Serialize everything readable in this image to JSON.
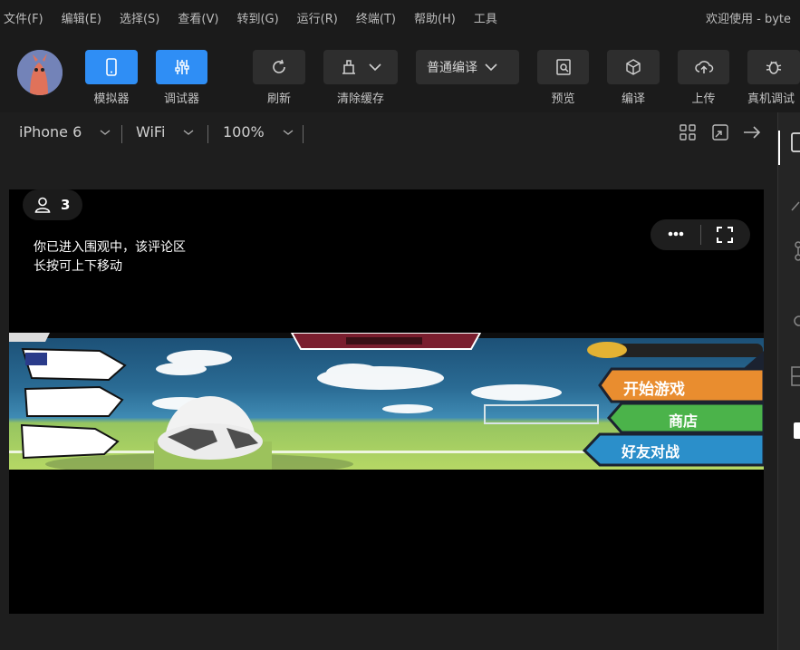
{
  "menu": {
    "items": [
      "文件(F)",
      "编辑(E)",
      "选择(S)",
      "查看(V)",
      "转到(G)",
      "运行(R)",
      "终端(T)",
      "帮助(H)",
      "工具"
    ],
    "welcome": "欢迎使用 - byte"
  },
  "toolbar": {
    "simulator_label": "模拟器",
    "debugger_label": "调试器",
    "refresh_label": "刷新",
    "clear_cache_label": "清除缓存",
    "compile_mode": "普通编译",
    "preview_label": "预览",
    "compile_label": "编译",
    "upload_label": "上传",
    "device_debug_label": "真机调试"
  },
  "device": {
    "model": "iPhone 6",
    "network": "WiFi",
    "zoom": "100%"
  },
  "simulator": {
    "viewer_count": "3",
    "notice_line1": "你已进入围观中，该评论区",
    "notice_line2": "长按可上下移动"
  },
  "game": {
    "start_label": "开始游戏",
    "shop_label": "商店",
    "friend_battle_label": "好友对战"
  },
  "colors": {
    "accent": "#2f8ef5",
    "background": "#1e1e1e"
  }
}
